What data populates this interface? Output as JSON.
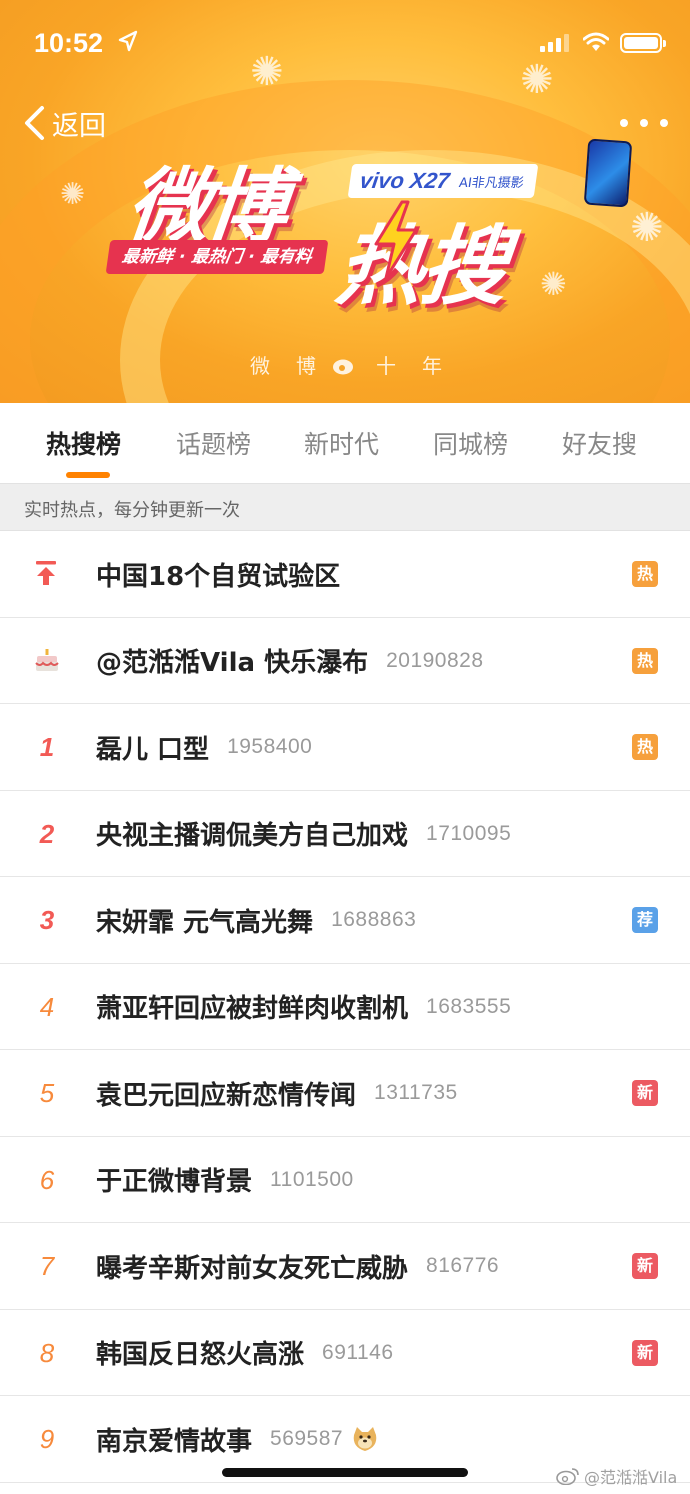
{
  "status_bar": {
    "time": "10:52",
    "icons": [
      "location-arrow-icon",
      "signal-icon",
      "wifi-icon",
      "battery-icon"
    ]
  },
  "nav": {
    "back_label": "返回",
    "more_icon": "more-dots-icon"
  },
  "banner": {
    "logo_part1": "微博",
    "logo_part2": "热搜",
    "slogan": "最新鲜 · 最热门 · 最有料",
    "sponsor_brand": "vivo X27",
    "sponsor_sub": "AI非凡摄影",
    "decade_left": "微博",
    "decade_right": "十年",
    "colors": {
      "background": "#ffbe3d",
      "logo_shadow": "#e6334f",
      "sponsor": "#3355cc"
    }
  },
  "tabs": [
    {
      "label": "热搜榜",
      "active": true
    },
    {
      "label": "话题榜",
      "active": false
    },
    {
      "label": "新时代",
      "active": false
    },
    {
      "label": "同城榜",
      "active": false
    },
    {
      "label": "好友搜",
      "active": false
    }
  ],
  "info_strip": {
    "text": "实时热点，每分钟更新一次"
  },
  "list": [
    {
      "rank": "",
      "rank_icon": "pin-top-icon",
      "title": "中国18个自贸试验区",
      "count": "",
      "tag": "热",
      "tag_color": "#f6a03c"
    },
    {
      "rank": "",
      "rank_icon": "birthday-cake-icon",
      "title": "@范湉湉Vila 快乐瀑布",
      "count": "20190828",
      "tag": "热",
      "tag_color": "#f6a03c"
    },
    {
      "rank": "1",
      "rank_style": "top",
      "title": "磊儿 口型",
      "count": "1958400",
      "tag": "热",
      "tag_color": "#f6a03c"
    },
    {
      "rank": "2",
      "rank_style": "top",
      "title": "央视主播调侃美方自己加戏",
      "count": "1710095",
      "tag": "",
      "tag_color": ""
    },
    {
      "rank": "3",
      "rank_style": "top",
      "title": "宋妍霏 元气高光舞",
      "count": "1688863",
      "tag": "荐",
      "tag_color": "#5aa1e8"
    },
    {
      "rank": "4",
      "rank_style": "mid",
      "title": "萧亚轩回应被封鲜肉收割机",
      "count": "1683555",
      "tag": "",
      "tag_color": ""
    },
    {
      "rank": "5",
      "rank_style": "mid",
      "title": "袁巴元回应新恋情传闻",
      "count": "1311735",
      "tag": "新",
      "tag_color": "#ec5a62"
    },
    {
      "rank": "6",
      "rank_style": "mid",
      "title": "于正微博背景",
      "count": "1101500",
      "tag": "",
      "tag_color": ""
    },
    {
      "rank": "7",
      "rank_style": "mid",
      "title": "曝考辛斯对前女友死亡威胁",
      "count": "816776",
      "tag": "新",
      "tag_color": "#ec5a62"
    },
    {
      "rank": "8",
      "rank_style": "mid",
      "title": "韩国反日怒火高涨",
      "count": "691146",
      "tag": "新",
      "tag_color": "#ec5a62"
    },
    {
      "rank": "9",
      "rank_style": "mid",
      "title": "南京爱情故事",
      "count": "569587",
      "tag": "",
      "tag_color": "",
      "emoji": "doge-emoji-icon"
    }
  ],
  "watermark": {
    "text": "@范湉湉Vila",
    "icon": "weibo-logo-icon"
  }
}
